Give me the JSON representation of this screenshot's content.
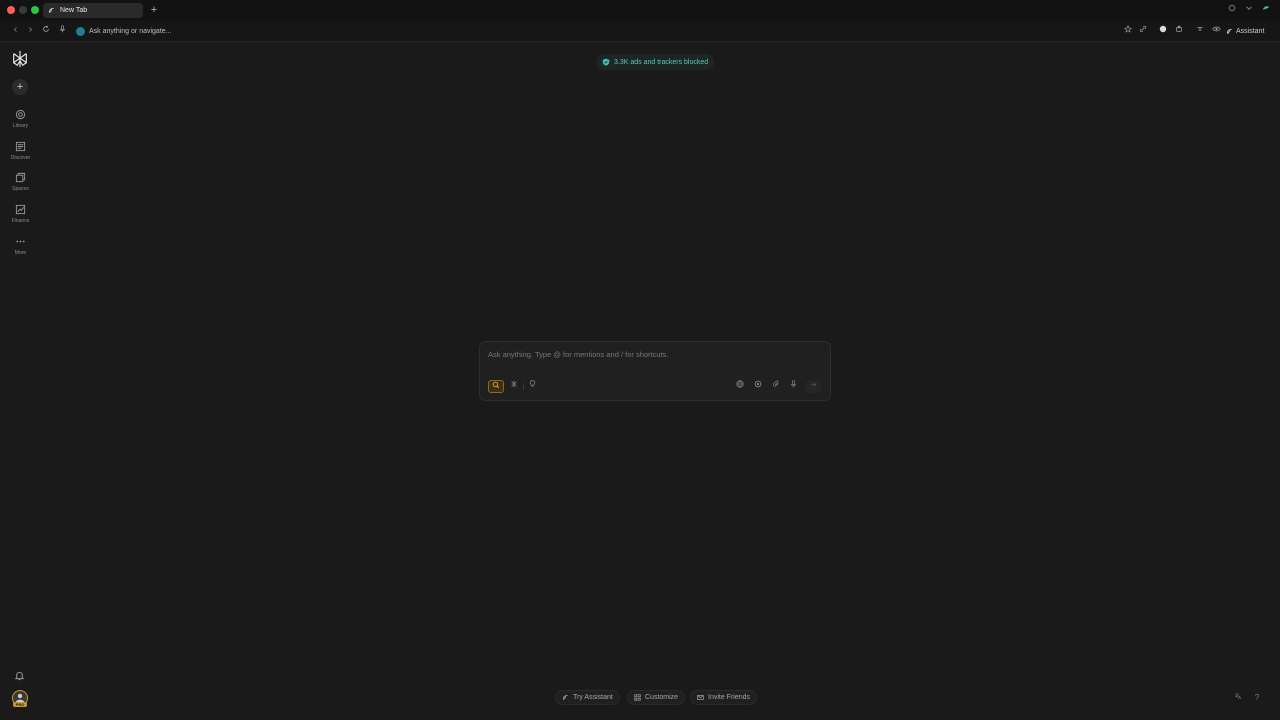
{
  "browser": {
    "tab_title": "New Tab",
    "new_tab_glyph": "+",
    "omnibox_placeholder": "Ask anything or navigate...",
    "assistant_label": "Assistant"
  },
  "sidebar": {
    "items": [
      {
        "label": "Library",
        "icon": "library-icon"
      },
      {
        "label": "Discover",
        "icon": "discover-icon"
      },
      {
        "label": "Spaces",
        "icon": "spaces-icon"
      },
      {
        "label": "Finance",
        "icon": "finance-icon"
      },
      {
        "label": "More",
        "icon": "more-icon"
      }
    ],
    "new_thread_glyph": "+",
    "pro_badge": "PRO"
  },
  "main": {
    "blocked_text": "3.3K ads and trackers blocked",
    "composer_placeholder": "Ask anything. Type @ for mentions and / for shortcuts."
  },
  "bottom": {
    "try_assistant": "Try Assistant",
    "customize": "Customize",
    "invite_friends": "Invite Friends",
    "help_glyph": "?"
  },
  "colors": {
    "accent_teal": "#20808d",
    "search_mode_amber": "#e0a63a",
    "background": "#1a1a1a"
  }
}
